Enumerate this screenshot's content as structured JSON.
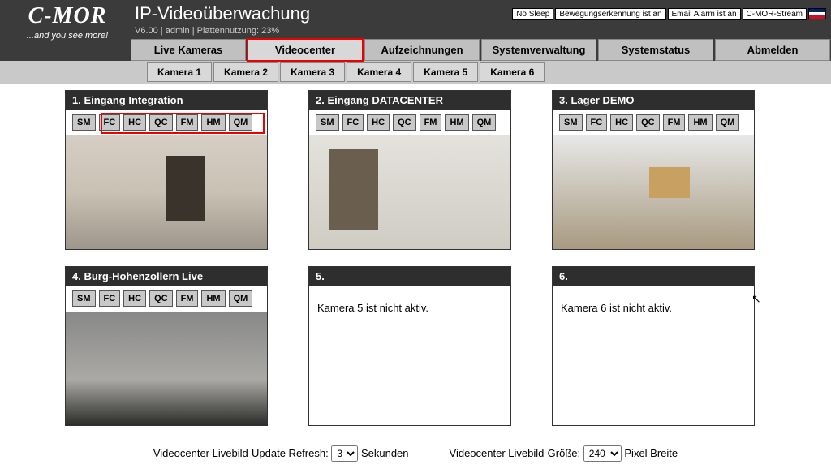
{
  "logo": {
    "brand": "C-MOR",
    "tagline": "...and you see more!"
  },
  "app_title": "IP-Videoüberwachung",
  "meta": "V6.00 | admin | Plattennutzung: 23%",
  "status_badges": [
    "No Sleep",
    "Bewegungserkennung ist an",
    "Email Alarm ist an",
    "C-MOR-Stream"
  ],
  "tabs_main": [
    {
      "label": "Live Kameras",
      "active": false
    },
    {
      "label": "Videocenter",
      "active": true,
      "highlight": true
    },
    {
      "label": "Aufzeichnungen",
      "active": false
    },
    {
      "label": "Systemverwaltung",
      "active": false
    },
    {
      "label": "Systemstatus",
      "active": false
    },
    {
      "label": "Abmelden",
      "active": false
    }
  ],
  "tabs_sub": [
    "Kamera 1",
    "Kamera 2",
    "Kamera 3",
    "Kamera 4",
    "Kamera 5",
    "Kamera 6"
  ],
  "cam_buttons": [
    "SM",
    "FC",
    "HC",
    "QC",
    "FM",
    "HM",
    "QM"
  ],
  "cameras": [
    {
      "title": "1. Eingang Integration",
      "active": true,
      "highlight_buttons": true,
      "img_class": "img1"
    },
    {
      "title": "2. Eingang DATACENTER",
      "active": true,
      "img_class": "img2"
    },
    {
      "title": "3. Lager DEMO",
      "active": true,
      "img_class": "img3"
    },
    {
      "title": "4. Burg-Hohenzollern Live",
      "active": true,
      "img_class": "img4"
    },
    {
      "title": "5.",
      "active": false,
      "inactive_msg": "Kamera 5 ist nicht aktiv."
    },
    {
      "title": "6.",
      "active": false,
      "inactive_msg": "Kamera 6 ist nicht aktiv."
    }
  ],
  "footer": {
    "refresh_label_pre": "Videocenter Livebild-Update Refresh:",
    "refresh_value": "3",
    "refresh_label_post": "Sekunden",
    "size_label_pre": "Videocenter Livebild-Größe:",
    "size_value": "240",
    "size_label_post": "Pixel Breite"
  }
}
